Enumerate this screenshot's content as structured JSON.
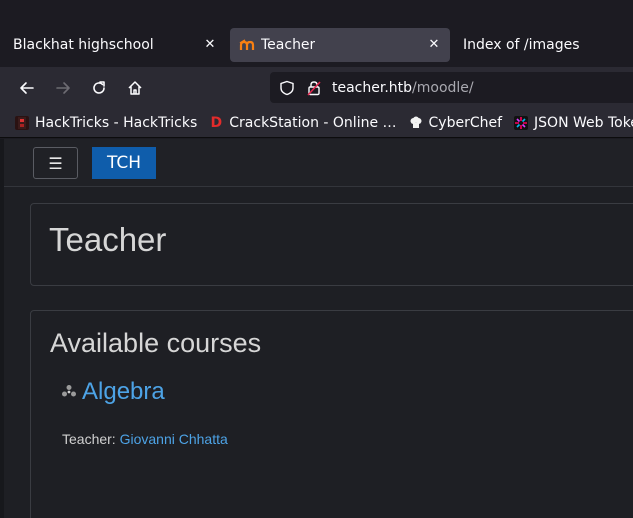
{
  "browser": {
    "tabs": [
      {
        "label": "Blackhat highschool",
        "active": false
      },
      {
        "label": "Teacher",
        "active": true
      },
      {
        "label": "Index of /images",
        "active": false
      }
    ],
    "tab_close_glyph": "✕",
    "url": {
      "host": "teacher.htb",
      "path": "/moodle/"
    },
    "bookmarks": [
      {
        "label": "HackTricks - HackTricks",
        "icon": "hacktricks-icon"
      },
      {
        "label": "CrackStation - Online …",
        "icon": "crackstation-icon"
      },
      {
        "label": "CyberChef",
        "icon": "cyberchef-icon"
      },
      {
        "label": "JSON Web Tokens",
        "icon": "jwt-icon"
      }
    ]
  },
  "moodle": {
    "hamburger_glyph": "☰",
    "brand": "TCH",
    "page_title": "Teacher",
    "section_title": "Available courses",
    "courses": [
      {
        "name": "Algebra",
        "teacher_label": "Teacher:",
        "teacher_name": "Giovanni Chhatta"
      }
    ]
  },
  "colors": {
    "accent": "#0f5dab",
    "link": "#4da3e6",
    "tab_active": "#42414d",
    "toolbar": "#2b2a33"
  }
}
